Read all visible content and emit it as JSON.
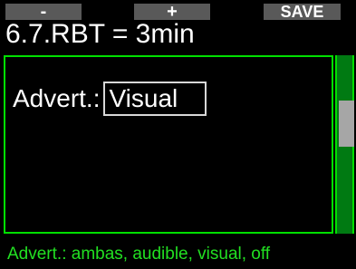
{
  "softkeys": {
    "left_label": "-",
    "middle_label": "+",
    "right_label": "SAVE"
  },
  "title": "6.7.RBT = 3min",
  "setting": {
    "label": "Advert.:",
    "value": "Visual"
  },
  "footer": {
    "hint": "Advert.: ambas, audible, visual, off"
  },
  "colors": {
    "accent_green": "#00e000",
    "scrollbar_green": "#007a12",
    "softkey_gray": "#595959",
    "hint_green": "#22e022"
  }
}
